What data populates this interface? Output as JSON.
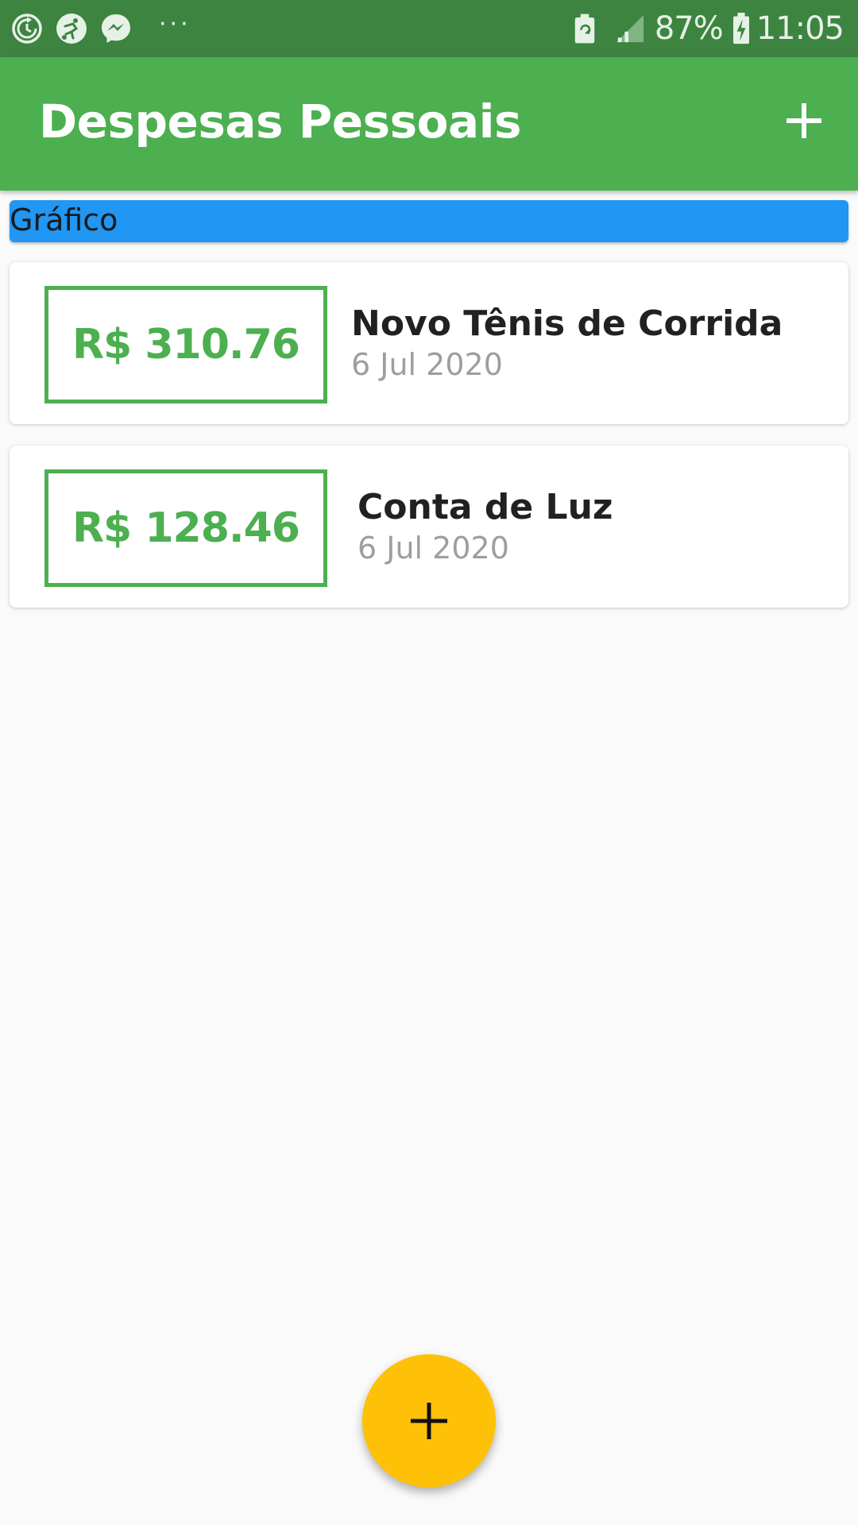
{
  "status_bar": {
    "left_icons": [
      "sync-icon",
      "soccer-app-icon",
      "messenger-icon"
    ],
    "more_indicator": "···",
    "right_icons": [
      "battery-saver-icon",
      "signal-icon",
      "battery-charging-icon"
    ],
    "battery_percent": "87%",
    "time": "11:05"
  },
  "app_bar": {
    "title": "Despesas Pessoais",
    "action_icon": "add-icon"
  },
  "chart": {
    "label": "Gráfico"
  },
  "transactions": [
    {
      "amount": "R$ 310.76",
      "title": "Novo Tênis de Corrida",
      "date": "6 Jul 2020"
    },
    {
      "amount": "R$ 128.46",
      "title": "Conta de Luz",
      "date": "6 Jul 2020"
    }
  ],
  "fab": {
    "icon": "add-icon"
  },
  "colors": {
    "status_bar": "#3c8440",
    "primary": "#4caf50",
    "chart_banner": "#2196f3",
    "fab": "#ffc107",
    "background": "#fafafa"
  }
}
